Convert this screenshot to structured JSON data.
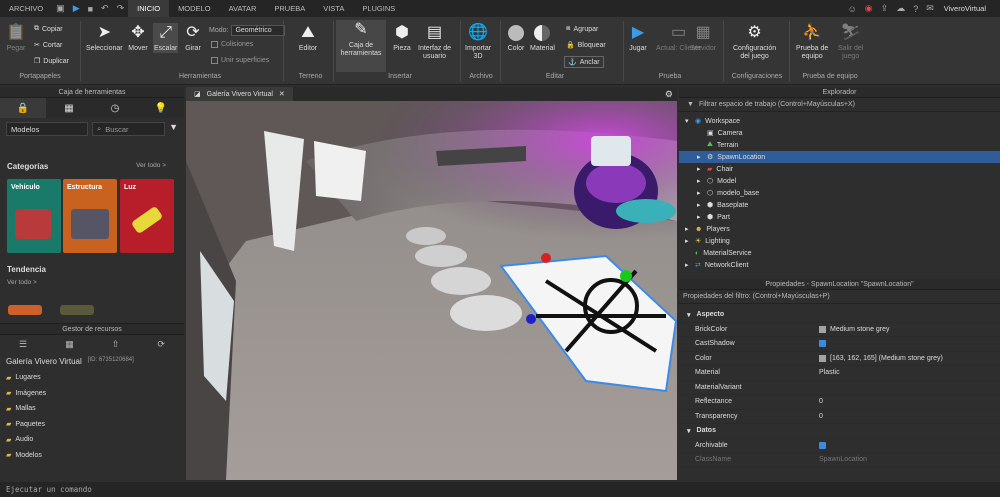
{
  "topbar": {
    "file": "ARCHIVO",
    "tabs": [
      "INICIO",
      "MODELO",
      "AVATAR",
      "PRUEBA",
      "VISTA",
      "PLUGINS"
    ],
    "user": "ViveroVirtual"
  },
  "ribbon": {
    "paste": "Pegar",
    "copy": "Copiar",
    "cut": "Cortar",
    "duplicate": "Duplicar",
    "clipboard_group": "Portapapeles",
    "select": "Seleccionar",
    "move": "Mover",
    "scale": "Escalar",
    "rotate": "Girar",
    "mode_label": "Modo:",
    "mode_value": "Geométrico",
    "collisions": "Colisiones",
    "join": "Unir superficies",
    "tools_group": "Herramientas",
    "editor": "Editor",
    "terrain_group": "Terreno",
    "toolbox_l1": "Caja de",
    "toolbox_l2": "herramientas",
    "part": "Pieza",
    "ui_l1": "Interfaz de",
    "ui_l2": "usuario",
    "insert_group": "Insertar",
    "import_l1": "Importar",
    "import_l2": "3D",
    "file_group": "Archivo",
    "color": "Color",
    "material": "Material",
    "group": "Agrupar",
    "lock": "Bloquear",
    "anchor": "Anclar",
    "edit_group": "Editar",
    "play": "Jugar",
    "current": "Actual: Cliente",
    "server": "Servidor",
    "test_group": "Prueba",
    "game_settings_l1": "Configuración",
    "game_settings_l2": "del juego",
    "settings_group": "Configuraciones",
    "team_test_l1": "Prueba de",
    "team_test_l2": "equipo",
    "exit_l1": "Salir del",
    "exit_l2": "juego",
    "team_group": "Prueba de equipo"
  },
  "toolbox": {
    "title": "Caja de herramientas",
    "category": "Modelos",
    "search_placeholder": "Buscar",
    "categories_title": "Categorías",
    "see_all": "Ver todo >",
    "cards": [
      "Vehículo",
      "Estructura",
      "Luz"
    ],
    "trending": "Tendencia",
    "trending_see": "Ver todo >"
  },
  "assets": {
    "title": "Gestor de recursos",
    "game": "Galería Vivero Virtual",
    "id": "[ID: 6735120684]",
    "items": [
      "Lugares",
      "Imágenes",
      "Mallas",
      "Paquetes",
      "Audio",
      "Modelos"
    ]
  },
  "viewport": {
    "tab": "Galería Vivero Virtual"
  },
  "explorer": {
    "title": "Explorador",
    "filter": "Filtrar espacio de trabajo (Control+Mayúsculas+X)",
    "items": [
      "Workspace",
      "Camera",
      "Terrain",
      "SpawnLocation",
      "Chair",
      "Model",
      "modelo_base",
      "Baseplate",
      "Part",
      "Players",
      "Lighting",
      "MaterialService",
      "NetworkClient"
    ]
  },
  "properties": {
    "title": "Propiedades - SpawnLocation \"SpawnLocation\"",
    "filter": "Propiedades del filtro: (Control+Mayúsculas+P)",
    "sec1": "Aspecto",
    "rows": [
      [
        "BrickColor",
        "Medium stone grey"
      ],
      [
        "CastShadow",
        ""
      ],
      [
        "Color",
        "[163, 162, 165] (Medium stone grey)"
      ],
      [
        "Material",
        "Plastic"
      ],
      [
        "MaterialVariant",
        ""
      ],
      [
        "Reflectance",
        "0"
      ],
      [
        "Transparency",
        "0"
      ]
    ],
    "sec2": "Datos",
    "archivable": "Archivable",
    "classname": "ClassName",
    "classname_val": "SpawnLocation"
  },
  "command": {
    "placeholder": "Ejecutar un comando"
  }
}
